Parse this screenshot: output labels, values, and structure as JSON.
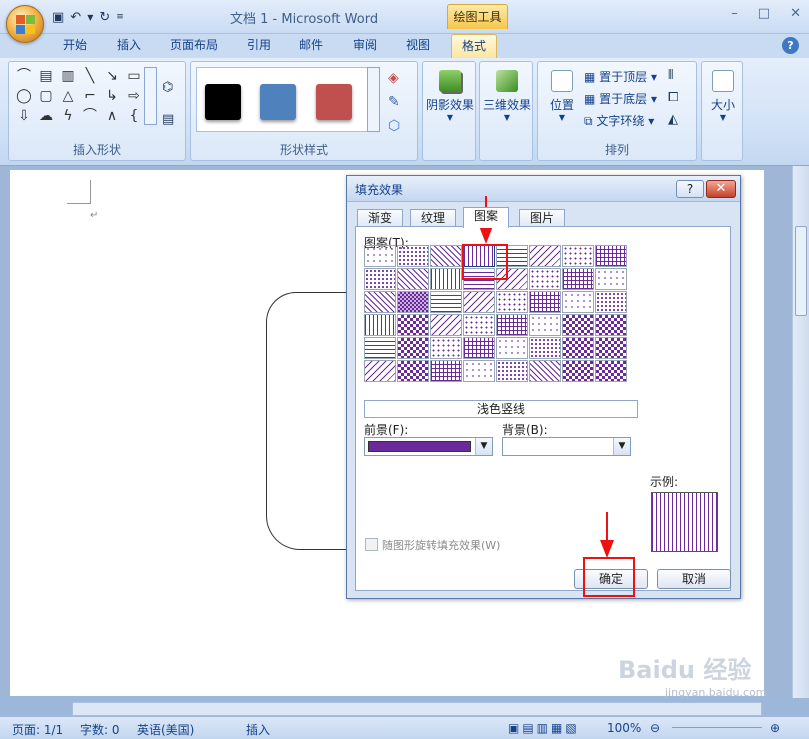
{
  "window": {
    "title": "文档 1 - Microsoft Word",
    "context_tab": "绘图工具",
    "controls": [
      "–",
      "□",
      "✕"
    ]
  },
  "ribbon_tabs": [
    {
      "label": "开始",
      "active": false
    },
    {
      "label": "插入",
      "active": false
    },
    {
      "label": "页面布局",
      "active": false
    },
    {
      "label": "引用",
      "active": false
    },
    {
      "label": "邮件",
      "active": false
    },
    {
      "label": "审阅",
      "active": false
    },
    {
      "label": "视图",
      "active": false
    },
    {
      "label": "格式",
      "active": true
    }
  ],
  "ribbon": {
    "groups": {
      "insert_shapes": "插入形状",
      "shape_styles": "形状样式",
      "shadow_effects": "阴影效果",
      "effects_3d": "三维效果",
      "arrange": "排列",
      "size": "大小"
    },
    "swatch_colors": [
      "#000000",
      "#4f81bd",
      "#c0504d"
    ],
    "buttons": {
      "shadow": "阴影效果",
      "effects3d": "三维效果",
      "position": "位置",
      "bring_front": "置于顶层",
      "send_back": "置于底层",
      "text_wrap": "文字环绕",
      "size": "大小"
    }
  },
  "dialog": {
    "title": "填充效果",
    "help": "?",
    "close": "✕",
    "tabs": [
      {
        "label": "渐变",
        "active": false
      },
      {
        "label": "纹理",
        "active": false
      },
      {
        "label": "图案",
        "active": true
      },
      {
        "label": "图片",
        "active": false
      }
    ],
    "pattern_label": "图案(T):",
    "selected_pattern_name": "浅色竖线",
    "foreground_label": "前景(F):",
    "background_label": "背景(B):",
    "foreground_color": "#6b2a9c",
    "background_color": "#ffffff",
    "sample_label": "示例:",
    "rotate_checkbox": "随图形旋转填充效果(W)",
    "ok": "确定",
    "cancel": "取消"
  },
  "statusbar": {
    "page": "页面: 1/1",
    "words": "字数: 0",
    "language": "英语(美国)",
    "mode": "插入",
    "zoom": "100%"
  },
  "watermark": "jingyan.baidu.com"
}
